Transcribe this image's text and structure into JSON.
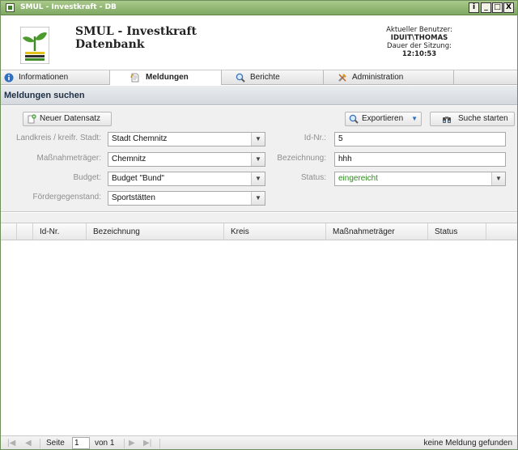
{
  "window": {
    "title": "SMUL - Investkraft - DB",
    "buttons": [
      "i",
      "_",
      "□",
      "X"
    ]
  },
  "header": {
    "app_name_line1": "SMUL - Investkraft",
    "app_name_line2": "Datenbank",
    "user_label": "Aktueller Benutzer:",
    "user_value": "IDUIT\\THOMAS",
    "session_label": "Dauer der Sitzung:",
    "session_value": "12:10:53"
  },
  "tabs": [
    {
      "label": "Informationen",
      "icon": "info-icon"
    },
    {
      "label": "Meldungen",
      "icon": "document-icon",
      "active": true
    },
    {
      "label": "Berichte",
      "icon": "magnifier-icon"
    },
    {
      "label": "Administration",
      "icon": "tools-icon"
    }
  ],
  "section": {
    "title": "Meldungen suchen"
  },
  "toolbar": {
    "new_label": "Neuer Datensatz",
    "export_label": "Exportieren",
    "search_label": "Suche starten"
  },
  "form": {
    "landkreis": {
      "label": "Landkreis / kreifr. Stadt:",
      "value": "Stadt Chemnitz"
    },
    "traeger": {
      "label": "Maßnahmeträger:",
      "value": "Chemnitz"
    },
    "budget": {
      "label": "Budget:",
      "value": "Budget \"Bund\""
    },
    "foerder": {
      "label": "Fördergegenstand:",
      "value": "Sportstätten"
    },
    "idnr": {
      "label": "Id-Nr.:",
      "value": "5"
    },
    "bezeichnung": {
      "label": "Bezeichnung:",
      "value": "hhh"
    },
    "status": {
      "label": "Status:",
      "value": "eingereicht"
    }
  },
  "grid": {
    "columns": [
      "Id-Nr.",
      "Bezeichnung",
      "Kreis",
      "Maßnahmeträger",
      "Status"
    ]
  },
  "pager": {
    "page_label": "Seite",
    "page_value": "1",
    "of_label": "von 1",
    "empty_text": "keine Meldung gefunden"
  },
  "colors": {
    "titlebar": "#7fa862",
    "status_green": "#2f8a1f"
  }
}
